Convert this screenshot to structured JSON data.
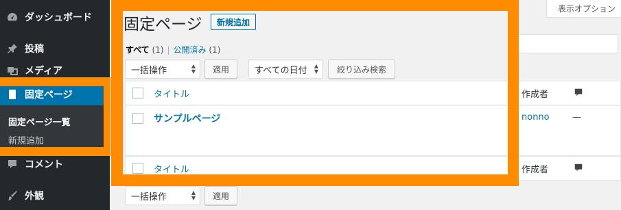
{
  "sidebar": {
    "items": [
      {
        "label": "ダッシュボード",
        "icon": "dashboard-icon"
      },
      {
        "label": "投稿",
        "icon": "pin-icon"
      },
      {
        "label": "メディア",
        "icon": "media-icon"
      },
      {
        "label": "固定ページ",
        "icon": "page-icon"
      },
      {
        "label": "コメント",
        "icon": "comment-icon"
      },
      {
        "label": "外観",
        "icon": "brush-icon"
      }
    ],
    "submenu": [
      {
        "label": "固定ページ一覧"
      },
      {
        "label": "新規追加"
      }
    ]
  },
  "screen_options": {
    "label": "表示オプション"
  },
  "header": {
    "title": "固定ページ",
    "add_new": "新規追加"
  },
  "filters": {
    "all_label": "すべて",
    "all_count": "(1)",
    "separator": "|",
    "published_label": "公開済み",
    "published_count": "(1)"
  },
  "tablenav_top": {
    "bulk_action": "一括操作",
    "apply": "適用",
    "date_filter": "すべての日付",
    "filter_button": "絞り込み検索"
  },
  "table": {
    "columns": {
      "title": "タイトル",
      "author": "作成者"
    },
    "rows": [
      {
        "title": "サンプルページ",
        "author": "nonno",
        "comments": "—"
      }
    ]
  },
  "tablenav_bottom": {
    "bulk_action": "一括操作",
    "apply": "適用"
  },
  "colors": {
    "highlight": "#ff8c00",
    "sidebar_bg": "#23282d",
    "current_menu_bg": "#0073aa",
    "link": "#0073aa"
  }
}
